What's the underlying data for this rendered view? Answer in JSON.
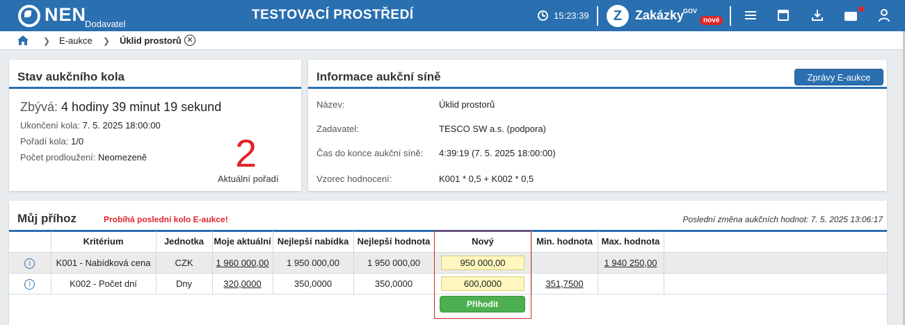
{
  "header": {
    "logo_text": "NEN",
    "logo_sub": "Dodavatel",
    "env_title": "TESTOVACÍ PROSTŘEDÍ",
    "time": "15:23:39",
    "zakazky_label": "Zakázky",
    "zakazky_sup": "GOV",
    "zakazky_badge": "nové",
    "colors": {
      "bar": "#2a6fb0",
      "badge": "#e0262b"
    }
  },
  "breadcrumb": {
    "items": [
      "E-aukce",
      "Úklid prostorů"
    ]
  },
  "status_panel": {
    "title": "Stav aukčního kola",
    "remaining_label": "Zbývá:",
    "remaining_value": "4 hodiny 39 minut 19 sekund",
    "end_label": "Ukončení kola:",
    "end_value": "7. 5. 2025 18:00:00",
    "order_label": "Pořadí kola:",
    "order_value": "1/0",
    "ext_label": "Počet prodloužení:",
    "ext_value": "Neomezeně",
    "rank_value": "2",
    "rank_label": "Aktuální pořadí"
  },
  "info_panel": {
    "title": "Informace aukční síně",
    "button_label": "Zprávy E-aukce",
    "rows": [
      {
        "label": "Název:",
        "value": "Úklid prostorů"
      },
      {
        "label": "Zadavatel:",
        "value": "TESCO SW a.s. (podpora)"
      },
      {
        "label": "Čas do konce aukční síně:",
        "value": "4:39:19 (7. 5. 2025 18:00:00)"
      },
      {
        "label": "Vzorec hodnocení:",
        "value": "K001 * 0,5 + K002 * 0,5"
      }
    ]
  },
  "bid_panel": {
    "title": "Můj příhoz",
    "warning": "Probíhá poslední kolo E-aukce!",
    "last_change": "Poslední změna aukčních hodnot: 7. 5. 2025 13:06:17",
    "columns": [
      "Kritérium",
      "Jednotka",
      "Moje aktuální",
      "Nejlepší nabídka",
      "Nejlepší hodnota",
      "Nový",
      "Min. hodnota",
      "Max. hodnota"
    ],
    "rows": [
      {
        "criterion": "K001 - Nabídková cena",
        "unit": "CZK",
        "current": "1 960 000,00",
        "best_offer": "1 950 000,00",
        "best_value": "1 950 000,00",
        "new": "950 000,00",
        "min": "",
        "max": "1 940 250,00"
      },
      {
        "criterion": "K002 - Počet dní",
        "unit": "Dny",
        "current": "320,0000",
        "best_offer": "350,0000",
        "best_value": "350,0000",
        "new": "600,0000",
        "min": "351,7500",
        "max": ""
      }
    ],
    "submit_label": "Přihodit"
  }
}
